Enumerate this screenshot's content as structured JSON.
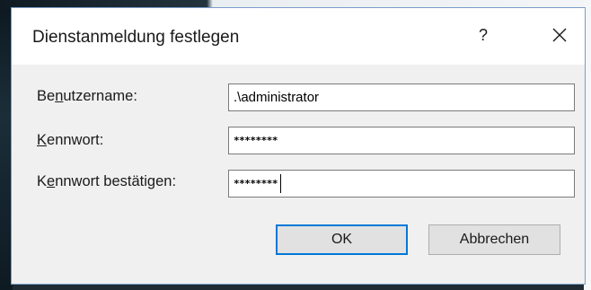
{
  "dialog": {
    "title": "Dienstanmeldung festlegen",
    "help_label": "?",
    "close_icon": "close-icon"
  },
  "form": {
    "username": {
      "label_before": "Be",
      "label_accel": "n",
      "label_after": "utzername:",
      "value": ".\\administrator"
    },
    "password": {
      "label_before": "",
      "label_accel": "K",
      "label_after": "ennwort:",
      "value": "********"
    },
    "confirm": {
      "label_before": "K",
      "label_accel": "e",
      "label_after": "nnwort bestätigen:",
      "value": "********"
    }
  },
  "buttons": {
    "ok": "OK",
    "cancel": "Abbrechen"
  }
}
